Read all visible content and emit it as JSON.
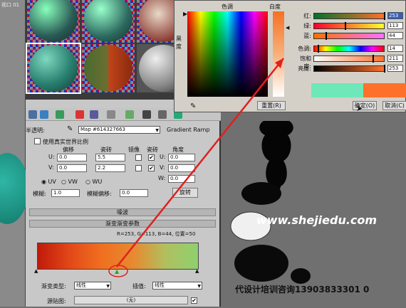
{
  "left_viewport": {
    "label": "视口 01"
  },
  "material_editor": {
    "opacity_label": "半透明:",
    "map_name": "Map #614327663",
    "map_type": "Gradient Ramp",
    "use_real_world": "使用真实世界比例",
    "coords_headers": {
      "offset": "偏移",
      "tiling": "瓷砖",
      "mirror": "镜像",
      "tile": "瓷砖",
      "angle": "角度"
    },
    "u_label": "U:",
    "v_label": "V:",
    "w_label": "W:",
    "u_offset": "0.0",
    "v_offset": "0.0",
    "u_tiling": "5.5",
    "v_tiling": "2.2",
    "u_angle": "0.0",
    "v_angle": "0.0",
    "w_angle": "0.0",
    "uv": "UV",
    "vw": "VW",
    "wu": "WU",
    "blur_label": "模糊:",
    "blur_value": "1.0",
    "blur_offset_label": "模糊偏移:",
    "blur_offset_value": "0.0",
    "rotate_button": "旋转",
    "noise_rollout": "噪波",
    "gradient_rollout": "渐变渐变参数",
    "gradient_info": "R=253, G=113, B=44, 位置=50",
    "gradient_type_label": "渐变类型:",
    "gradient_type": "线性",
    "interp_label": "插值:",
    "interp": "线性",
    "source_map_label": "源贴图:",
    "source_map_value": "(无)"
  },
  "color_picker": {
    "hue_label": "色调",
    "whiteness_label": "白度",
    "blackness_label": "黑度",
    "red_label": "红:",
    "green_label": "绿:",
    "blue_label": "蓝:",
    "hue_row_label": "色调:",
    "sat_label": "饱和度:",
    "val_label": "亮度:",
    "red": "253",
    "green": "113",
    "blue": "44",
    "hue": "14",
    "sat": "211",
    "val": "253",
    "reset_button": "重置(R)",
    "ok_button": "确定(O)",
    "cancel_button": "取消(C)",
    "old_color": "#6ee8b8",
    "new_color": "#fd712c"
  },
  "watermark": "www.shejiedu.com",
  "contact": "代设计培训咨询13903833301 0"
}
